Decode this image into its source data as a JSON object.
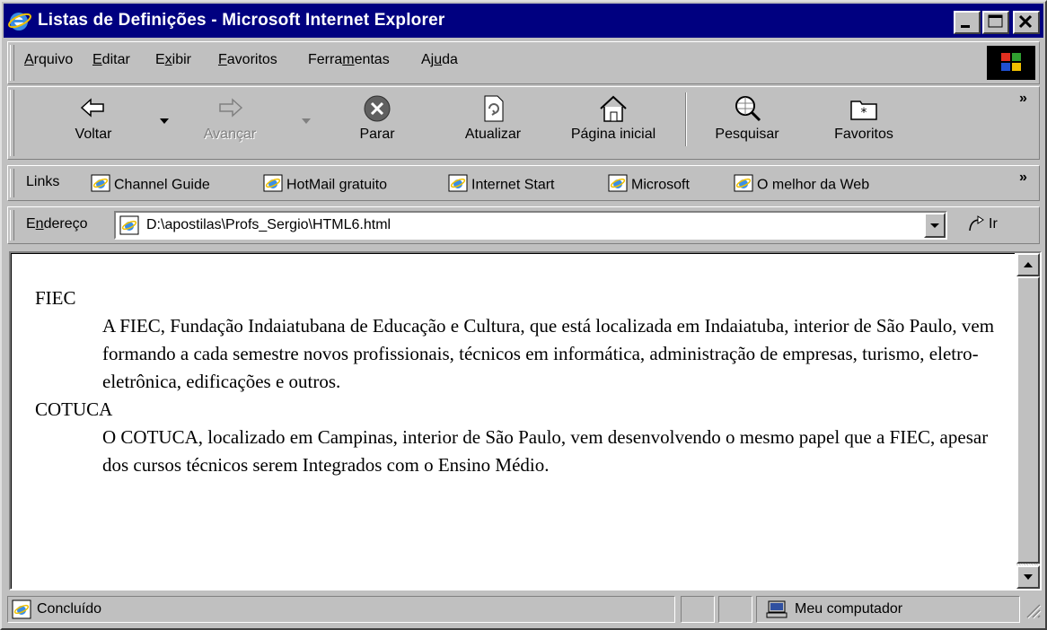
{
  "window": {
    "title": "Listas de Definições - Microsoft Internet Explorer"
  },
  "titlebar_buttons": {
    "minimize": "_",
    "maximize": "□",
    "close": "×"
  },
  "menu": [
    {
      "prefix": "",
      "accel": "A",
      "rest": "rquivo"
    },
    {
      "prefix": "",
      "accel": "E",
      "rest": "ditar"
    },
    {
      "prefix": "E",
      "accel": "x",
      "rest": "ibir"
    },
    {
      "prefix": "",
      "accel": "F",
      "rest": "avoritos"
    },
    {
      "prefix": "Ferra",
      "accel": "m",
      "rest": "entas"
    },
    {
      "prefix": "Aj",
      "accel": "u",
      "rest": "da"
    }
  ],
  "toolbar": {
    "back": "Voltar",
    "forward": "Avançar",
    "stop": "Parar",
    "refresh": "Atualizar",
    "home": "Página inicial",
    "search": "Pesquisar",
    "favorites": "Favoritos",
    "chevron": "»"
  },
  "links": {
    "label": "Links",
    "items": [
      "Channel Guide",
      "HotMail gratuito",
      "Internet Start",
      "Microsoft",
      "O melhor da Web"
    ],
    "chevron": "»"
  },
  "address": {
    "label_prefix": "E",
    "label_accel": "n",
    "label_rest": "dereço",
    "value": "D:\\apostilas\\Profs_Sergio\\HTML6.html",
    "go_label": "Ir"
  },
  "content": {
    "terms": [
      {
        "term": "FIEC",
        "definition": "A FIEC, Fundação Indaiatubana de Educação e Cultura, que está localizada em Indaiatuba, interior de São Paulo, vem formando a cada semestre novos profissionais, técnicos em informática, administração de empresas, turismo, eletro-eletrônica, edificações e outros."
      },
      {
        "term": "COTUCA",
        "definition": "O COTUCA, localizado em Campinas, interior de São Paulo, vem desenvolvendo o mesmo papel que a FIEC, apesar dos cursos técnicos serem Integrados com o Ensino Médio."
      }
    ]
  },
  "status": {
    "text": "Concluído",
    "zone": "Meu computador"
  },
  "colors": {
    "titlebar": "#000080",
    "face": "#c0c0c0",
    "content_bg": "#ffffff"
  }
}
